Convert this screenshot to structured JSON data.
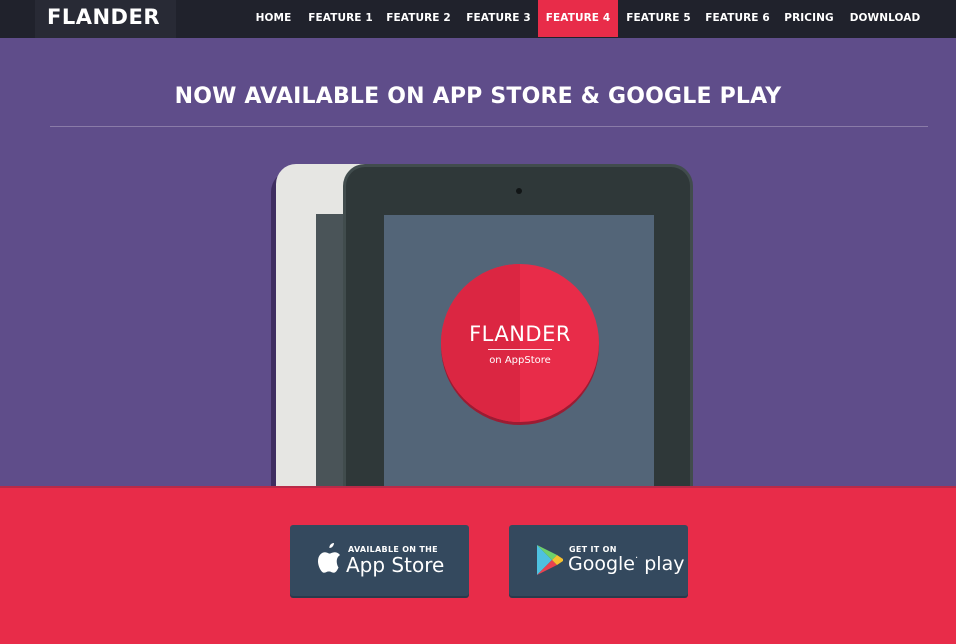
{
  "nav": {
    "logo": "FLANDER",
    "items": [
      {
        "label": "HOME",
        "active": false
      },
      {
        "label": "FEATURE 1",
        "active": false
      },
      {
        "label": "FEATURE 2",
        "active": false
      },
      {
        "label": "FEATURE 3",
        "active": false
      },
      {
        "label": "FEATURE 4",
        "active": true
      },
      {
        "label": "FEATURE 5",
        "active": false
      },
      {
        "label": "FEATURE 6",
        "active": false
      },
      {
        "label": "PRICING",
        "active": false
      },
      {
        "label": "DOWNLOAD",
        "active": false
      }
    ]
  },
  "hero": {
    "title": "NOW AVAILABLE ON APP STORE & GOOGLE PLAY"
  },
  "badge": {
    "title": "FLANDER",
    "subtitle": "on AppStore"
  },
  "stores": {
    "apple": {
      "small": "AVAILABLE ON THE",
      "big": "App Store",
      "icon": "apple-icon"
    },
    "google": {
      "small": "GET IT ON",
      "big_google": "Google",
      "big_play": "play",
      "icon": "google-play-icon"
    }
  },
  "colors": {
    "accent": "#e82c49",
    "hero_bg": "#5f4d8a",
    "nav_bg": "#20222c",
    "button_bg": "#34495e"
  }
}
